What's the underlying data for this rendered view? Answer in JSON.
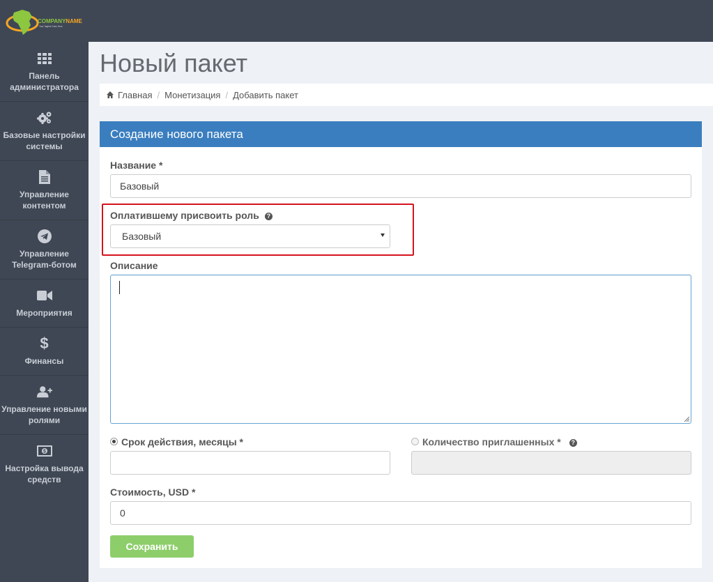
{
  "brand": {
    "name_part1": "COMPANY",
    "name_part2": "NAME",
    "tagline": "Your Tagline Goes Here",
    "accent": "#8dc63f",
    "orbit": "#f5a623"
  },
  "sidebar": {
    "items": [
      {
        "label_l1": "Панель",
        "label_l2": "администратора",
        "icon": "grid-icon"
      },
      {
        "label_l1": "Базовые настройки",
        "label_l2": "системы",
        "icon": "gears-icon"
      },
      {
        "label_l1": "Управление",
        "label_l2": "контентом",
        "icon": "document-icon"
      },
      {
        "label_l1": "Управление",
        "label_l2": "Telegram-ботом",
        "icon": "telegram-icon"
      },
      {
        "label_l1": "Мероприятия",
        "label_l2": "",
        "icon": "video-camera-icon"
      },
      {
        "label_l1": "Финансы",
        "label_l2": "",
        "icon": "dollar-icon"
      },
      {
        "label_l1": "Управление новыми",
        "label_l2": "ролями",
        "icon": "user-plus-icon"
      },
      {
        "label_l1": "Настройка вывода",
        "label_l2": "средств",
        "icon": "money-icon"
      }
    ]
  },
  "page": {
    "title": "Новый пакет",
    "breadcrumb": [
      "Главная",
      "Монетизация",
      "Добавить пакет"
    ]
  },
  "form": {
    "header": "Создание нового пакета",
    "name_label": "Название *",
    "name_value": "Базовый",
    "role_label": "Оплатившему присвоить роль",
    "role_value": "Базовый",
    "description_label": "Описание",
    "duration_label": "Срок действия, месяцы *",
    "duration_value": "",
    "invites_label": "Количество приглашенных *",
    "invites_value": "",
    "price_label": "Стоимость, USD *",
    "price_value": "0",
    "save_label": "Сохранить",
    "help_glyph": "?"
  },
  "colors": {
    "sidebar_bg": "#3f4754",
    "panel_header": "#3a7ebf",
    "save_button": "#8dce6b",
    "highlight": "#d5131f"
  }
}
